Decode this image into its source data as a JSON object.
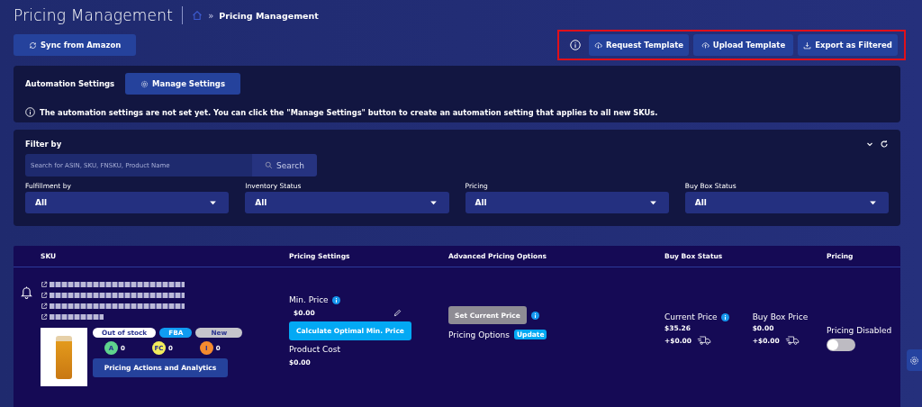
{
  "header": {
    "title": "Pricing Management",
    "breadcrumb_separator": "»",
    "breadcrumb": "Pricing Management"
  },
  "toolbar": {
    "sync_button": "Sync from Amazon",
    "actions": [
      {
        "label": "Request Template",
        "kind": "download-cloud"
      },
      {
        "label": "Upload Template",
        "kind": "upload-cloud"
      },
      {
        "label": "Export as Filtered",
        "kind": "download"
      }
    ]
  },
  "automation": {
    "label": "Automation Settings",
    "button": "Manage Settings",
    "notice": "The automation settings are not set yet. You can click the \"Manage Settings\" button to create an automation setting that applies to all new SKUs."
  },
  "filter": {
    "title": "Filter by",
    "search_placeholder": "Search for ASIN, SKU, FNSKU, Product Name",
    "search_button": "Search",
    "selects": [
      {
        "label": "Fulfillment by",
        "value": "All"
      },
      {
        "label": "Inventory Status",
        "value": "All"
      },
      {
        "label": "Pricing",
        "value": "All"
      },
      {
        "label": "Buy Box Status",
        "value": "All"
      }
    ]
  },
  "table": {
    "columns": [
      "SKU",
      "Pricing Settings",
      "Advanced Pricing Options",
      "Buy Box Status",
      "Pricing"
    ],
    "rows": [
      {
        "tags": [
          {
            "label": "Out of stock",
            "kind": "stock"
          },
          {
            "label": "FBA",
            "kind": "channel"
          },
          {
            "label": "New",
            "kind": "condition"
          }
        ],
        "counters": [
          {
            "label": "A",
            "value": "0",
            "color": "#5fd38d"
          },
          {
            "label": "FC",
            "value": "0",
            "color": "#f2ec5c"
          },
          {
            "label": "I",
            "value": "0",
            "color": "#f58a2e"
          }
        ],
        "actions_button": "Pricing Actions and Analytics",
        "min_price_label": "Min. Price",
        "min_price": "$0.00",
        "calc_button": "Calculate Optimal Min. Price",
        "product_cost_label": "Product Cost",
        "product_cost": "$0.00",
        "set_price_button": {
          "label": "Set Current Price",
          "disabled": true
        },
        "pricing_options_label": "Pricing Options",
        "update_badge": "Update",
        "current_price_label": "Current Price",
        "current_price": "$35.26",
        "current_shipping": "+$0.00",
        "buybox_price_label": "Buy Box Price",
        "buybox_price": "$0.00",
        "buybox_shipping": "+$0.00",
        "pricing_status": "Pricing Disabled",
        "pricing_on": false
      }
    ]
  }
}
